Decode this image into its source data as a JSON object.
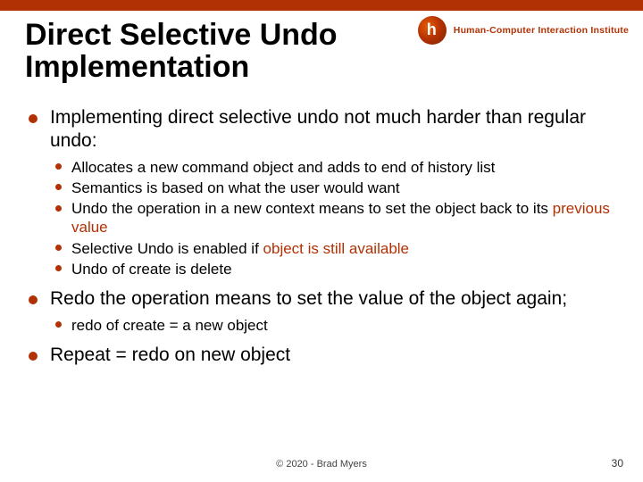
{
  "header": {
    "logo_label": "Human-Computer Interaction Institute"
  },
  "title": "Direct Selective Undo\nImplementation",
  "bullets": [
    {
      "text": "Implementing direct selective undo not much harder than regular undo:",
      "children": [
        {
          "text": "Allocates a new command object and adds to end of history list"
        },
        {
          "text": "Semantics is based on what the user would want"
        },
        {
          "pre": "Undo the operation in a new context means to set the object back to its ",
          "hl": "previous value"
        },
        {
          "pre": "Selective Undo is enabled if ",
          "hl": "object is still available"
        },
        {
          "text": "Undo of create is delete"
        }
      ]
    },
    {
      "text": "Redo the operation means to set the value of the object again;",
      "children": [
        {
          "text": "redo of create = a new object"
        }
      ]
    },
    {
      "text": "Repeat = redo on new object"
    }
  ],
  "footer": {
    "copyright": "© 2020 - Brad Myers"
  },
  "page_number": "30"
}
